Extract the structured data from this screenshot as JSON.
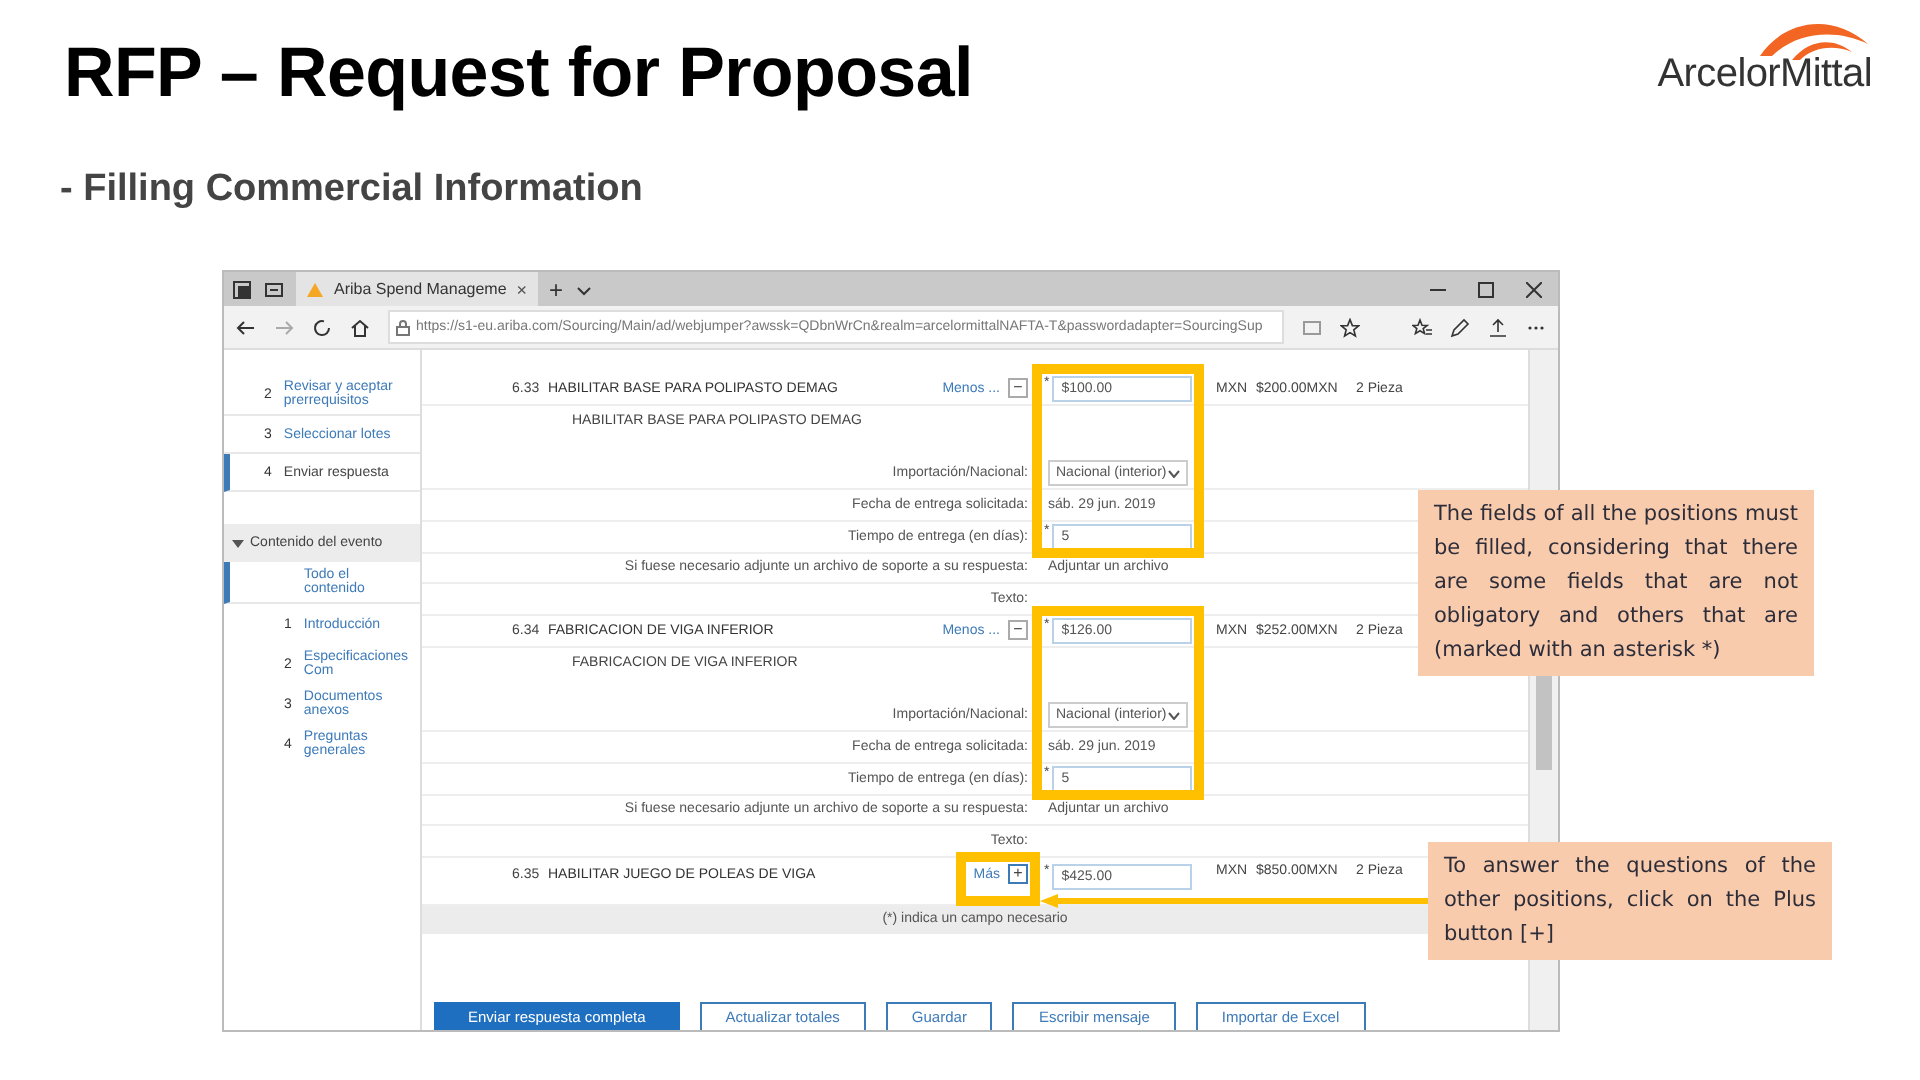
{
  "slide": {
    "title": "RFP – Request for Proposal",
    "logo": "ArcelorMittal",
    "subtitle": "- Filling Commercial Information"
  },
  "browser": {
    "tabs": [
      {
        "label": "Ariba Spend Manageme",
        "selected": true,
        "close": "×"
      }
    ],
    "new_tab": "+",
    "url": "https://s1-eu.ariba.com/Sourcing/Main/ad/webjumper?awssk=QDbnWrCn&realm=arcelormittalNAFTA-T&passwordadapter=SourcingSup"
  },
  "sidebar": {
    "steps": [
      {
        "number": "2",
        "label": "Revisar y aceptar prerrequisitos",
        "selected": false
      },
      {
        "number": "3",
        "label": "Seleccionar lotes",
        "selected": false
      },
      {
        "number": "4",
        "label": "Enviar respuesta",
        "selected": true
      }
    ],
    "section": {
      "label": "Contenido del evento",
      "expanded": true
    },
    "contents": [
      {
        "label": "Todo el contenido",
        "selected": true
      },
      {
        "number": "1",
        "label": "Introducción",
        "selected": false
      },
      {
        "number": "2",
        "label": "Especificaciones Com",
        "selected": false
      },
      {
        "number": "3",
        "label": "Documentos anexos",
        "selected": false
      },
      {
        "number": "4",
        "label": "Preguntas generales",
        "selected": false
      }
    ]
  },
  "items": [
    {
      "number": "6.33",
      "name": "HABILITAR BASE PARA POLIPASTO DEMAG",
      "toggle_link": "Menos ...",
      "toggle": "−",
      "expanded": true,
      "price_mark": "*",
      "price": "$100.00",
      "currency": "MXN",
      "total": "$200.00MXN",
      "quantity": "2 Pieza",
      "description": "HABILITAR BASE PARA POLIPASTO DEMAG",
      "fields": [
        {
          "kind": "select",
          "label": "Importación/Nacional:",
          "value": "Nacional (interior)"
        },
        {
          "kind": "text",
          "label": "Fecha de entrega solicitada:",
          "value": "sáb. 29 jun. 2019"
        },
        {
          "kind": "input",
          "label": "Tiempo de entrega (en días):",
          "mark": "*",
          "value": "5"
        },
        {
          "kind": "link",
          "label": "Si fuese necesario adjunte un archivo de soporte a su respuesta:",
          "value": "Adjuntar un archivo"
        },
        {
          "kind": "heading",
          "label": "Texto:"
        }
      ]
    },
    {
      "number": "6.34",
      "name": "FABRICACION DE VIGA INFERIOR",
      "toggle_link": "Menos ...",
      "toggle": "−",
      "expanded": true,
      "price_mark": "*",
      "price": "$126.00",
      "currency": "MXN",
      "total": "$252.00MXN",
      "quantity": "2 Pieza",
      "description": "FABRICACION DE VIGA INFERIOR",
      "fields": [
        {
          "kind": "select",
          "label": "Importación/Nacional:",
          "value": "Nacional (interior)"
        },
        {
          "kind": "text",
          "label": "Fecha de entrega solicitada:",
          "value": "sáb. 29 jun. 2019"
        },
        {
          "kind": "input",
          "label": "Tiempo de entrega (en días):",
          "mark": "*",
          "value": "5"
        },
        {
          "kind": "link",
          "label": "Si fuese necesario adjunte un archivo de soporte a su respuesta:",
          "value": "Adjuntar un archivo"
        },
        {
          "kind": "heading",
          "label": "Texto:"
        }
      ]
    },
    {
      "number": "6.35",
      "name": "HABILITAR JUEGO DE POLEAS DE VIGA",
      "toggle_link": "Más",
      "toggle": "+",
      "expanded": false,
      "price_mark": "*",
      "price": "$425.00",
      "currency": "MXN",
      "total": "$850.00MXN",
      "quantity": "2 Pieza"
    }
  ],
  "footnote": "(*) indica un campo necesario",
  "buttons": [
    {
      "label": "Enviar respuesta completa",
      "primary": true
    },
    {
      "label": "Actualizar totales",
      "primary": false
    },
    {
      "label": "Guardar",
      "primary": false
    },
    {
      "label": "Escribir mensaje",
      "primary": false
    },
    {
      "label": "Importar de Excel",
      "primary": false
    }
  ],
  "callouts": [
    "The fields of all the positions must be filled, considering that there are some fields that are not obligatory and others that are (marked with an asterisk *)",
    "To answer the questions of the other positions, click on the Plus button [+]"
  ]
}
